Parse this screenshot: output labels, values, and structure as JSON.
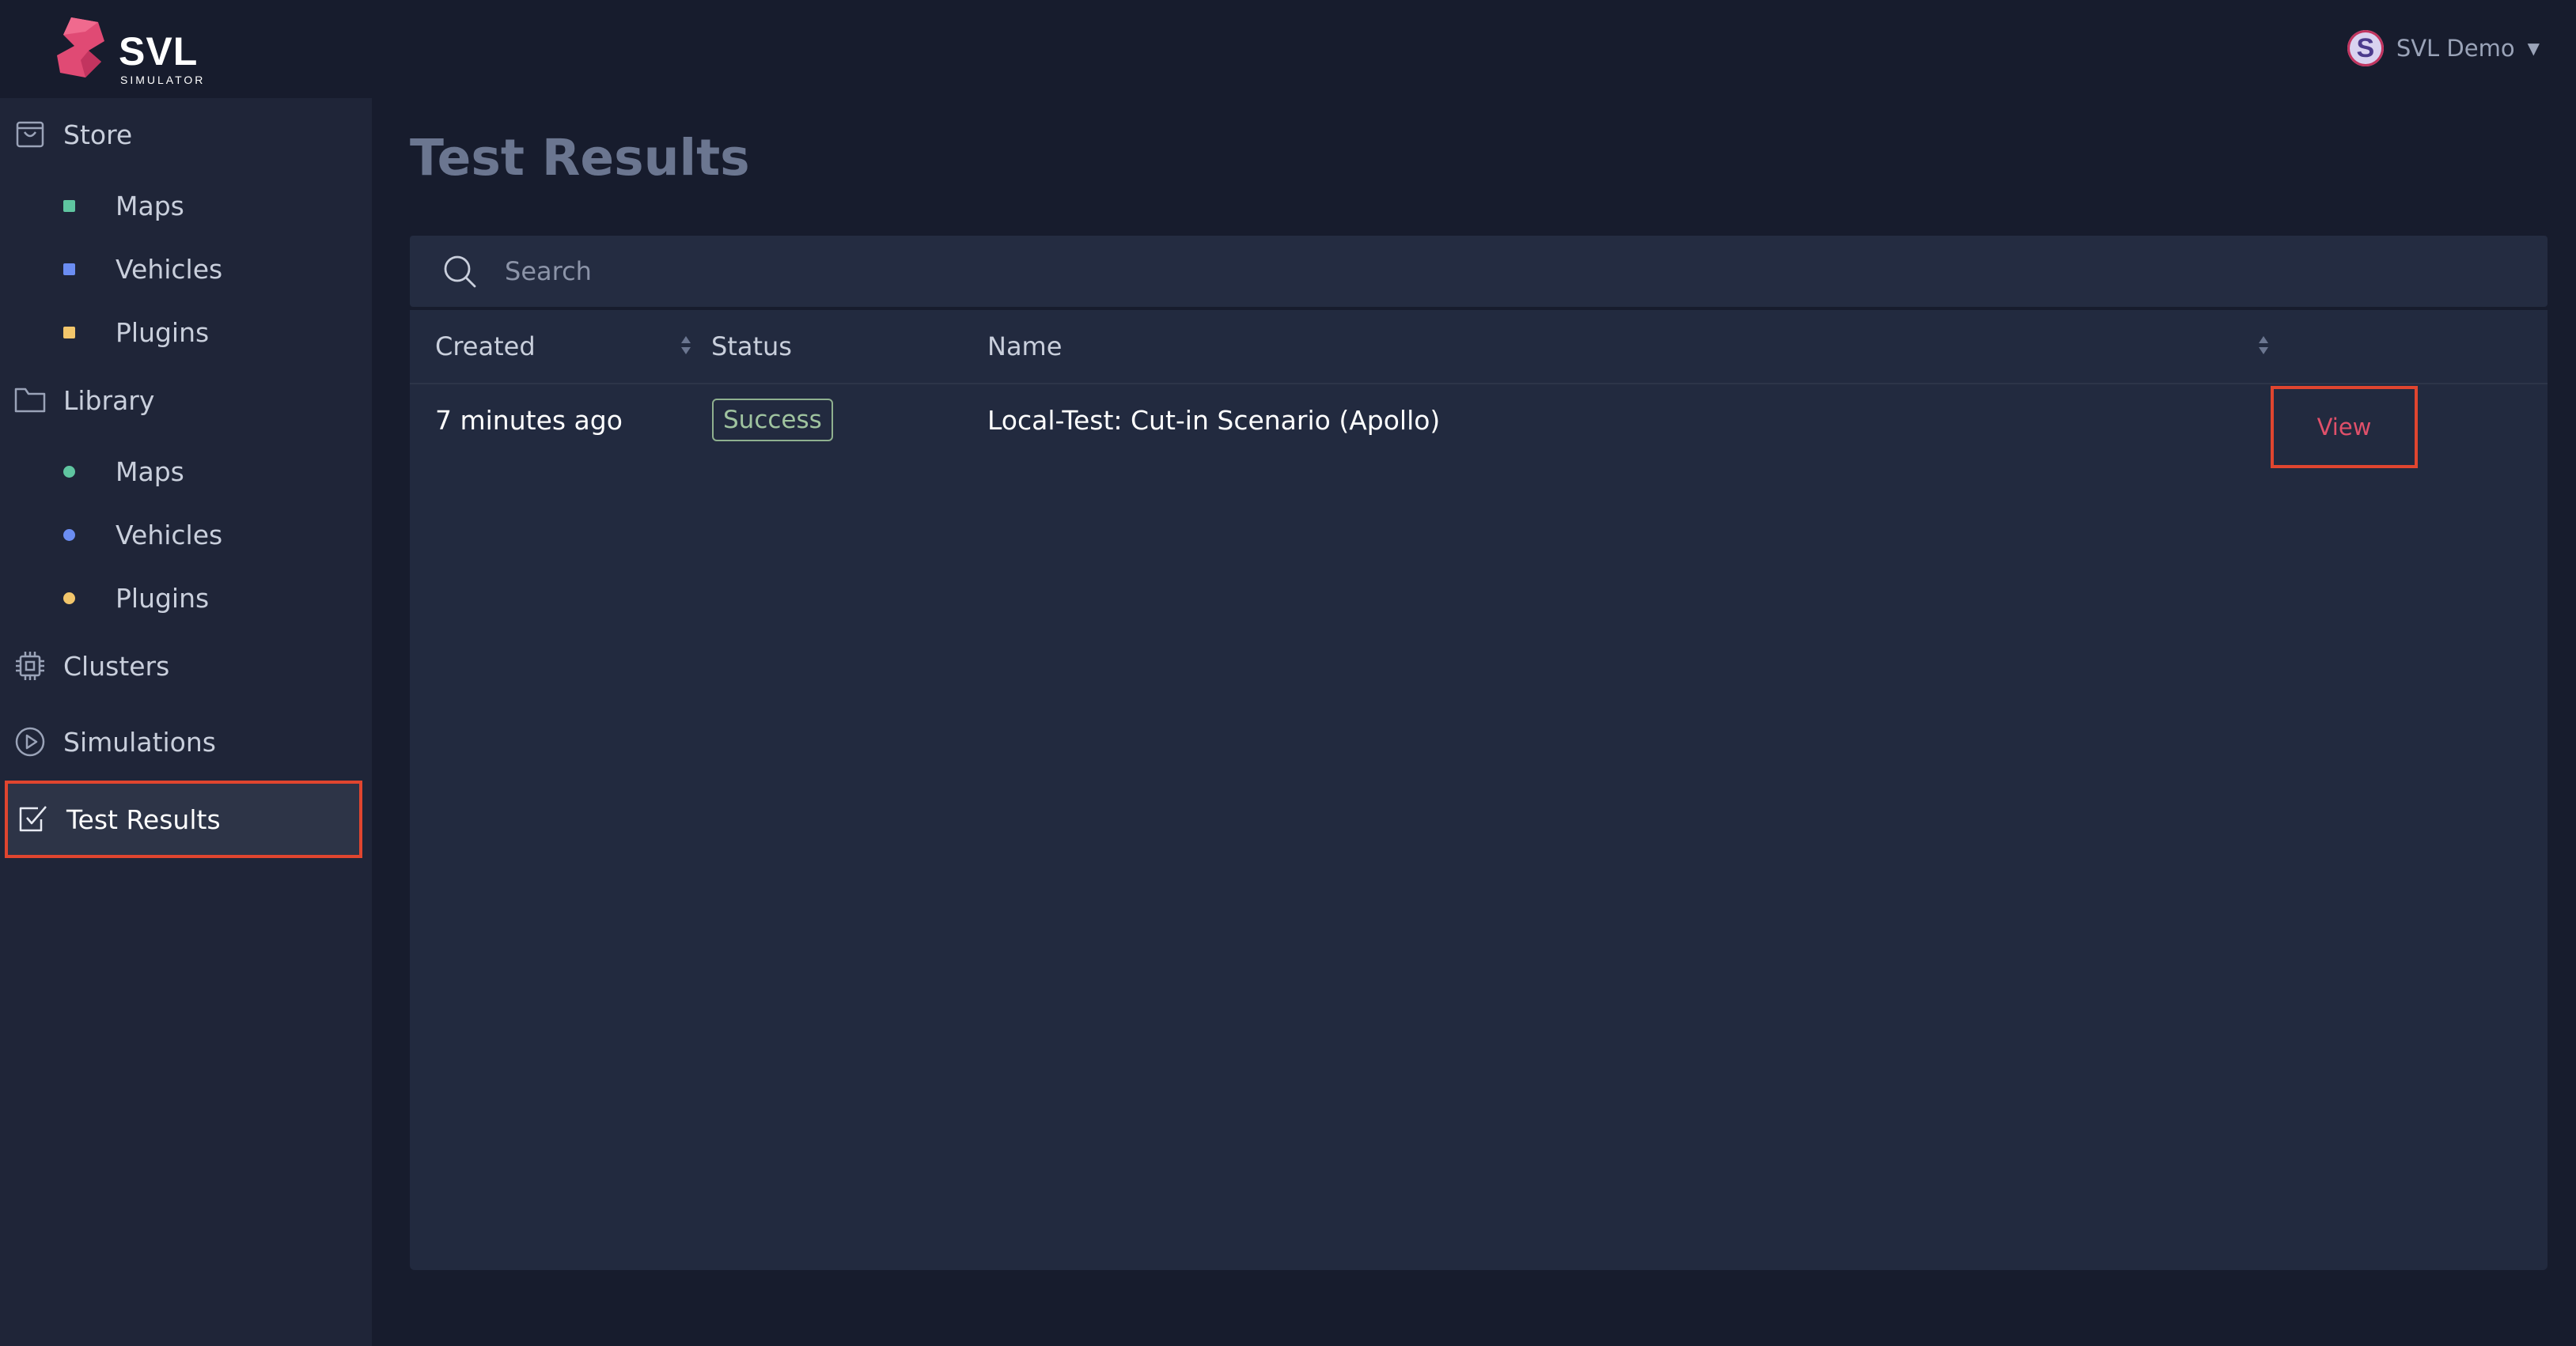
{
  "brand": {
    "name": "SVL",
    "subtitle": "SIMULATOR"
  },
  "user": {
    "initial": "S",
    "name": "SVL Demo"
  },
  "sidebar": {
    "store": {
      "label": "Store",
      "icon": "shopping-bag-icon"
    },
    "store_items": [
      {
        "label": "Maps",
        "color": "#5fc5a0"
      },
      {
        "label": "Vehicles",
        "color": "#6b8df2"
      },
      {
        "label": "Plugins",
        "color": "#f2c66b"
      }
    ],
    "library": {
      "label": "Library",
      "icon": "folder-icon"
    },
    "library_items": [
      {
        "label": "Maps",
        "color": "#5fc5a0"
      },
      {
        "label": "Vehicles",
        "color": "#6b8df2"
      },
      {
        "label": "Plugins",
        "color": "#f2c66b"
      }
    ],
    "clusters": {
      "label": "Clusters",
      "icon": "cpu-icon"
    },
    "simulations": {
      "label": "Simulations",
      "icon": "play-circle-icon"
    },
    "test_results": {
      "label": "Test Results",
      "icon": "check-square-icon"
    }
  },
  "main": {
    "title": "Test Results",
    "search": {
      "placeholder": "Search"
    },
    "table": {
      "headers": {
        "created": "Created",
        "status": "Status",
        "name": "Name"
      },
      "rows": [
        {
          "created": "7 minutes ago",
          "status": "Success",
          "name": "Local-Test: Cut-in Scenario (Apollo)",
          "action": "View"
        }
      ]
    }
  }
}
